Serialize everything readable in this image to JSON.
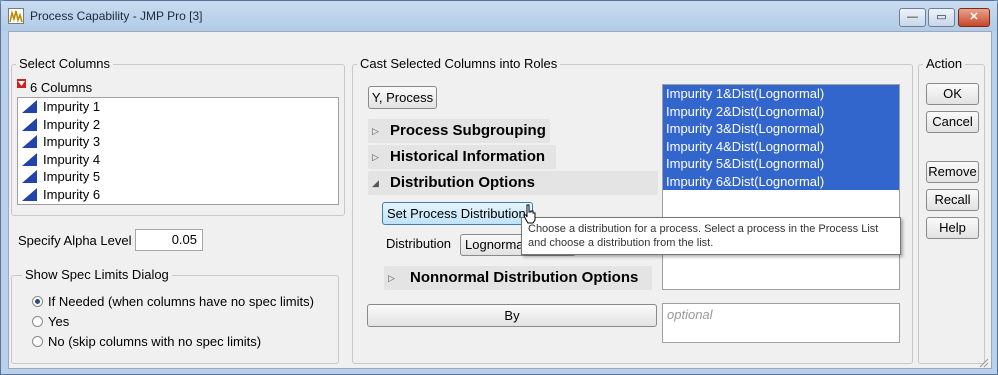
{
  "window": {
    "title": "Process Capability - JMP Pro [3]",
    "min_glyph": "—",
    "max_glyph": "▭",
    "close_glyph": "✕"
  },
  "select_columns": {
    "title": "Select Columns",
    "count_label": "6 Columns",
    "items": [
      "Impurity 1",
      "Impurity 2",
      "Impurity 3",
      "Impurity 4",
      "Impurity 5",
      "Impurity 6"
    ]
  },
  "alpha": {
    "label": "Specify Alpha Level",
    "value": "0.05"
  },
  "spec_limits": {
    "title": "Show Spec Limits Dialog",
    "options": [
      "If Needed (when columns have no spec limits)",
      "Yes",
      "No (skip columns with no spec limits)"
    ],
    "selected": 0
  },
  "roles": {
    "title": "Cast Selected Columns into Roles",
    "y_process_button": "Y, Process",
    "process_subgrouping": "Process Subgrouping",
    "historical_information": "Historical Information",
    "distribution_options": "Distribution Options",
    "set_process_distribution_button": "Set Process Distribution",
    "distribution_label": "Distribution",
    "distribution_value": "Lognormal",
    "nonnormal_options": "Nonnormal Distribution Options",
    "by_button": "By",
    "by_placeholder": "optional",
    "y_list": [
      "Impurity 1&Dist(Lognormal)",
      "Impurity 2&Dist(Lognormal)",
      "Impurity 3&Dist(Lognormal)",
      "Impurity 4&Dist(Lognormal)",
      "Impurity 5&Dist(Lognormal)",
      "Impurity 6&Dist(Lognormal)"
    ],
    "tooltip": "Choose a distribution for a process. Select a process in the Process List and choose a distribution from the list."
  },
  "action": {
    "title": "Action",
    "ok": "OK",
    "cancel": "Cancel",
    "remove": "Remove",
    "recall": "Recall",
    "help": "Help"
  },
  "colors": {
    "selection": "#3366cc",
    "title_bar": "#b9d1ea",
    "column_icon": "#2244aa"
  }
}
